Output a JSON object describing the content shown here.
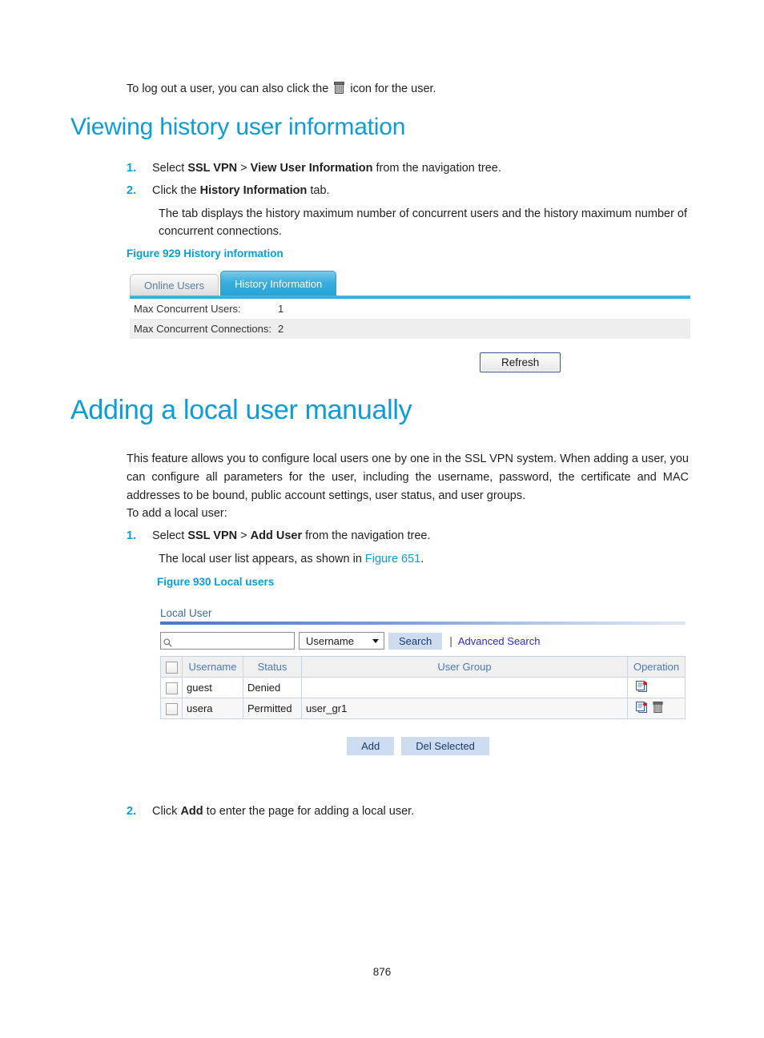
{
  "intro": {
    "before_icon": "To log out a user, you can also click the",
    "icon": "trash-icon",
    "after_icon": "icon for the user."
  },
  "section1": {
    "title": "Viewing history user information",
    "steps": [
      {
        "num": "1.",
        "pre": "Select ",
        "b1": "SSL VPN",
        "mid": " > ",
        "b2": "View User Information",
        "post": " from the navigation tree."
      },
      {
        "num": "2.",
        "pre": "Click the ",
        "b1": "History Information",
        "mid": "",
        "b2": "",
        "post": " tab."
      }
    ],
    "step2_note": "The tab displays the history maximum number of concurrent users and the history maximum number of concurrent connections.",
    "figure_caption": "Figure 929 History information"
  },
  "figure929": {
    "tabs": [
      {
        "label": "Online Users",
        "active": false
      },
      {
        "label": "History Information",
        "active": true
      }
    ],
    "rows": [
      {
        "label": "Max Concurrent Users:",
        "value": "1"
      },
      {
        "label": "Max Concurrent Connections:",
        "value": "2"
      }
    ],
    "refresh_label": "Refresh"
  },
  "section2": {
    "title": "Adding a local user manually",
    "paragraph": "This feature allows you to configure local users one by one in the SSL VPN system. When adding a user, you can configure all parameters for the user, including the username, password, the certificate and MAC addresses to be bound, public account settings, user status, and user groups.",
    "lead_in": "To add a local user:",
    "step1": {
      "num": "1.",
      "pre": "Select ",
      "b1": "SSL VPN",
      "mid": " > ",
      "b2": "Add User",
      "post": " from the navigation tree."
    },
    "step1_note_pre": "The local user list appears, as shown in ",
    "step1_note_link": "Figure 651",
    "step1_note_post": ".",
    "figure_caption": "Figure 930 Local users",
    "step2": {
      "num": "2.",
      "pre": "Click ",
      "b1": "Add",
      "post": " to enter the page for adding a local user."
    }
  },
  "figure930": {
    "panel_title": "Local User",
    "search": {
      "value": "",
      "placeholder": "",
      "field_selected": "Username",
      "field_options": [
        "Username"
      ],
      "search_button": "Search",
      "separator": "|",
      "advanced_link": "Advanced Search",
      "search_icon": "magnifier-icon"
    },
    "table": {
      "columns": [
        "",
        "Username",
        "Status",
        "User Group",
        "Operation"
      ],
      "rows": [
        {
          "checked": false,
          "username": "guest",
          "status": "Denied",
          "user_group": "",
          "operations": [
            "edit-icon"
          ]
        },
        {
          "checked": false,
          "username": "usera",
          "status": "Permitted",
          "user_group": "user_gr1",
          "operations": [
            "edit-icon",
            "delete-icon"
          ]
        }
      ]
    },
    "buttons": {
      "add": "Add",
      "del_selected": "Del Selected"
    }
  },
  "footer": {
    "page_number": "876"
  },
  "colors": {
    "accent_blue": "#0b9dd7",
    "link_blue": "#2b2bcc",
    "table_header_text": "#4a76c4",
    "panel_rule": "#4a77c4"
  }
}
